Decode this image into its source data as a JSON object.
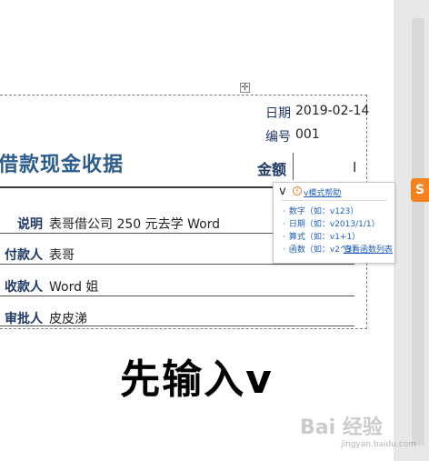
{
  "document": {
    "title": "借款现金收据",
    "date_label": "日期",
    "date_value": "2019-02-14",
    "number_label": "编号",
    "number_value": "001",
    "amount_label": "金额",
    "amount_input": "v",
    "fields": [
      {
        "label": "说明",
        "value": "表哥借公司 250 元去学 Word"
      },
      {
        "label": "付款人",
        "value": "表哥"
      },
      {
        "label": "收款人",
        "value": "Word 姐"
      },
      {
        "label": "审批人",
        "value": "皮皮涕"
      }
    ]
  },
  "popup": {
    "help_link": "v模式帮助",
    "items": [
      "数字（如：v123）",
      "日期（如：v2013/1/1）",
      "算式（如：v1+1）",
      "函数（如：v2^3）"
    ],
    "more_link": "查看函数列表"
  },
  "caption": "先输入v",
  "watermark": "Bai 经验",
  "watermark_sub": "jingyan.baidu.com",
  "icons": {
    "move_handle": "move-handle-icon",
    "info": "info-icon",
    "text_cursor": "text-cursor-icon",
    "side_app": "sogou-input-icon"
  },
  "colors": {
    "label": "#1f3864",
    "title": "#2e5c8a",
    "link": "#2060b8",
    "accent_orange": "#f58220"
  }
}
